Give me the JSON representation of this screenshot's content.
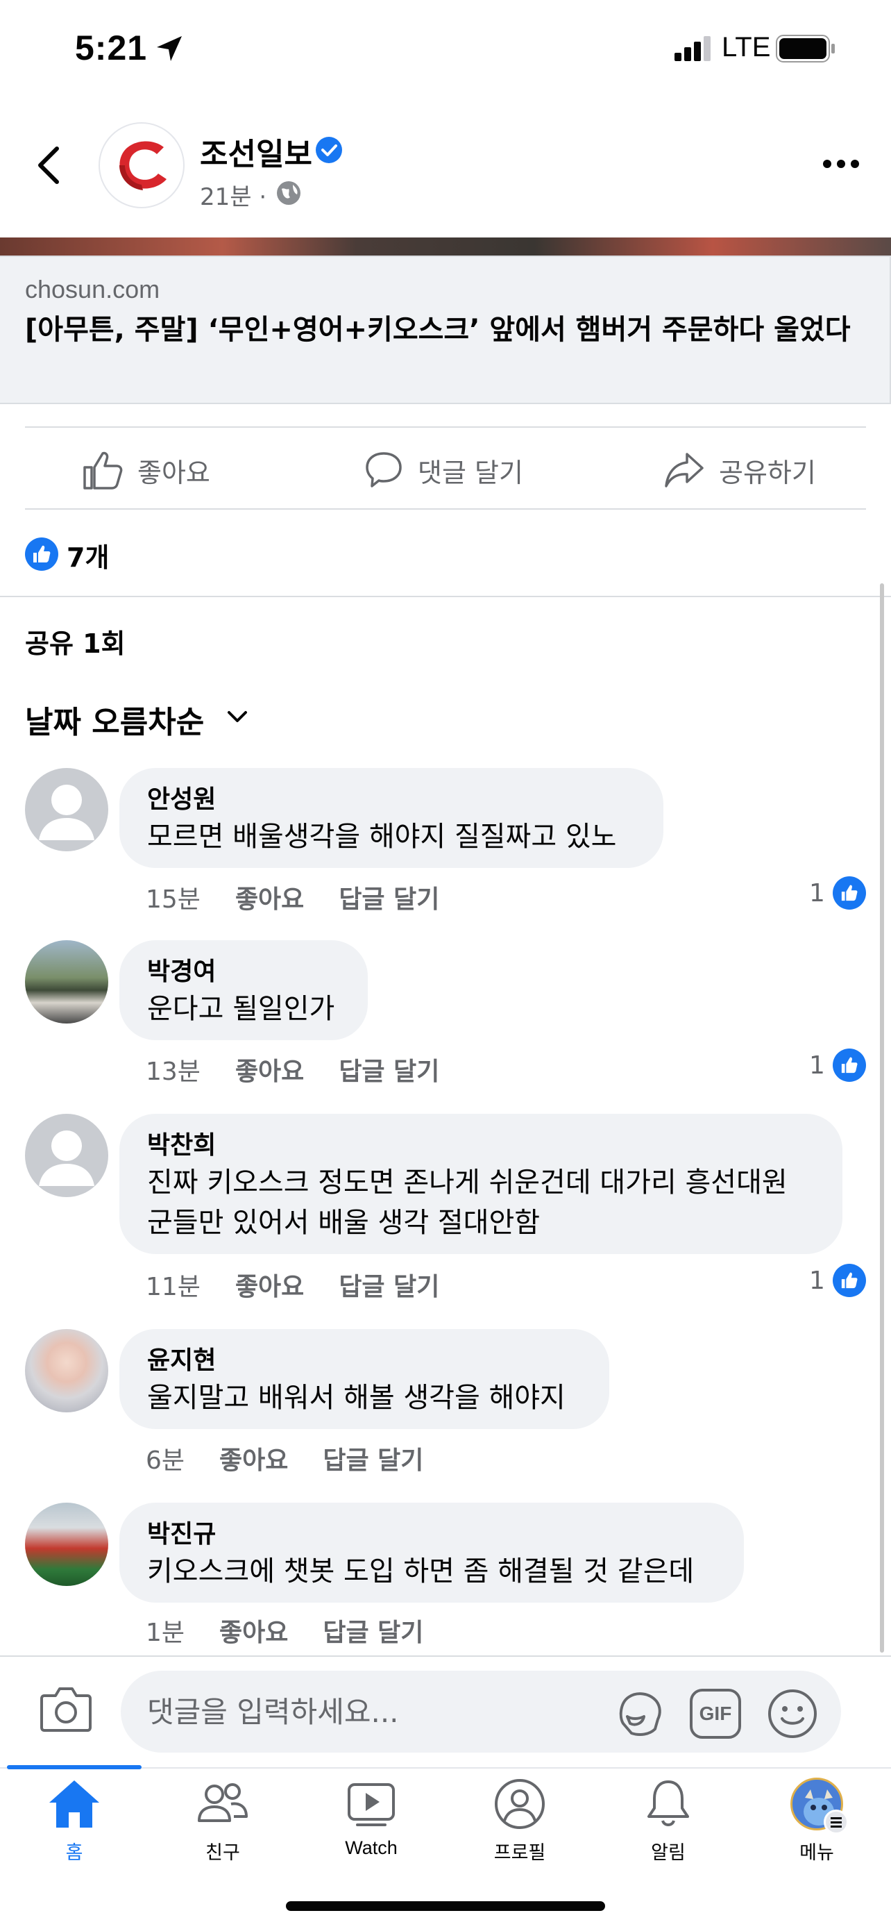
{
  "status_bar": {
    "time": "5:21",
    "network": "LTE"
  },
  "header": {
    "page_name": "조선일보",
    "post_time": "21분 ·"
  },
  "link_preview": {
    "domain": "chosun.com",
    "title": "[아무튼, 주말] ‘무인+영어+키오스크’ 앞에서 햄버거 주문하다 울었다"
  },
  "actions": {
    "like": "좋아요",
    "comment": "댓글 달기",
    "share": "공유하기"
  },
  "reactions": {
    "count": "7개"
  },
  "shares": {
    "label": "공유 1회"
  },
  "sort": {
    "label": "날짜 오름차순"
  },
  "comments": [
    {
      "name": "안성원",
      "text": "모르면 배울생각을 해야지 질질짜고 있노",
      "time": "15분",
      "like": "좋아요",
      "reply": "답글 달기",
      "likes": "1"
    },
    {
      "name": "박경여",
      "text": "운다고 될일인가",
      "time": "13분",
      "like": "좋아요",
      "reply": "답글 달기",
      "likes": "1"
    },
    {
      "name": "박찬희",
      "text_line1": "진짜 키오스크 정도면 존나게 쉬운건데 대가리 흥선대원",
      "text_line2": "군들만 있어서 배울 생각 절대안함",
      "time": "11분",
      "like": "좋아요",
      "reply": "답글 달기",
      "likes": "1"
    },
    {
      "name": "윤지현",
      "text": "울지말고 배워서 해볼 생각을 해야지",
      "time": "6분",
      "like": "좋아요",
      "reply": "답글 달기"
    },
    {
      "name": "박진규",
      "text": "키오스크에 챗봇 도입 하면 좀 해결될 것 같은데",
      "time": "1분",
      "like": "좋아요",
      "reply": "답글 달기"
    }
  ],
  "composer": {
    "placeholder": "댓글을 입력하세요...",
    "gif_label": "GIF"
  },
  "tabs": [
    {
      "label": "홈",
      "icon": "home-icon"
    },
    {
      "label": "친구",
      "icon": "friends-icon"
    },
    {
      "label": "Watch",
      "icon": "watch-icon"
    },
    {
      "label": "프로필",
      "icon": "profile-icon"
    },
    {
      "label": "알림",
      "icon": "bell-icon"
    },
    {
      "label": "메뉴",
      "icon": "menu-avatar"
    }
  ],
  "colors": {
    "accent": "#1877f2",
    "bubble": "#f0f2f5",
    "secondary_text": "#65676b"
  }
}
